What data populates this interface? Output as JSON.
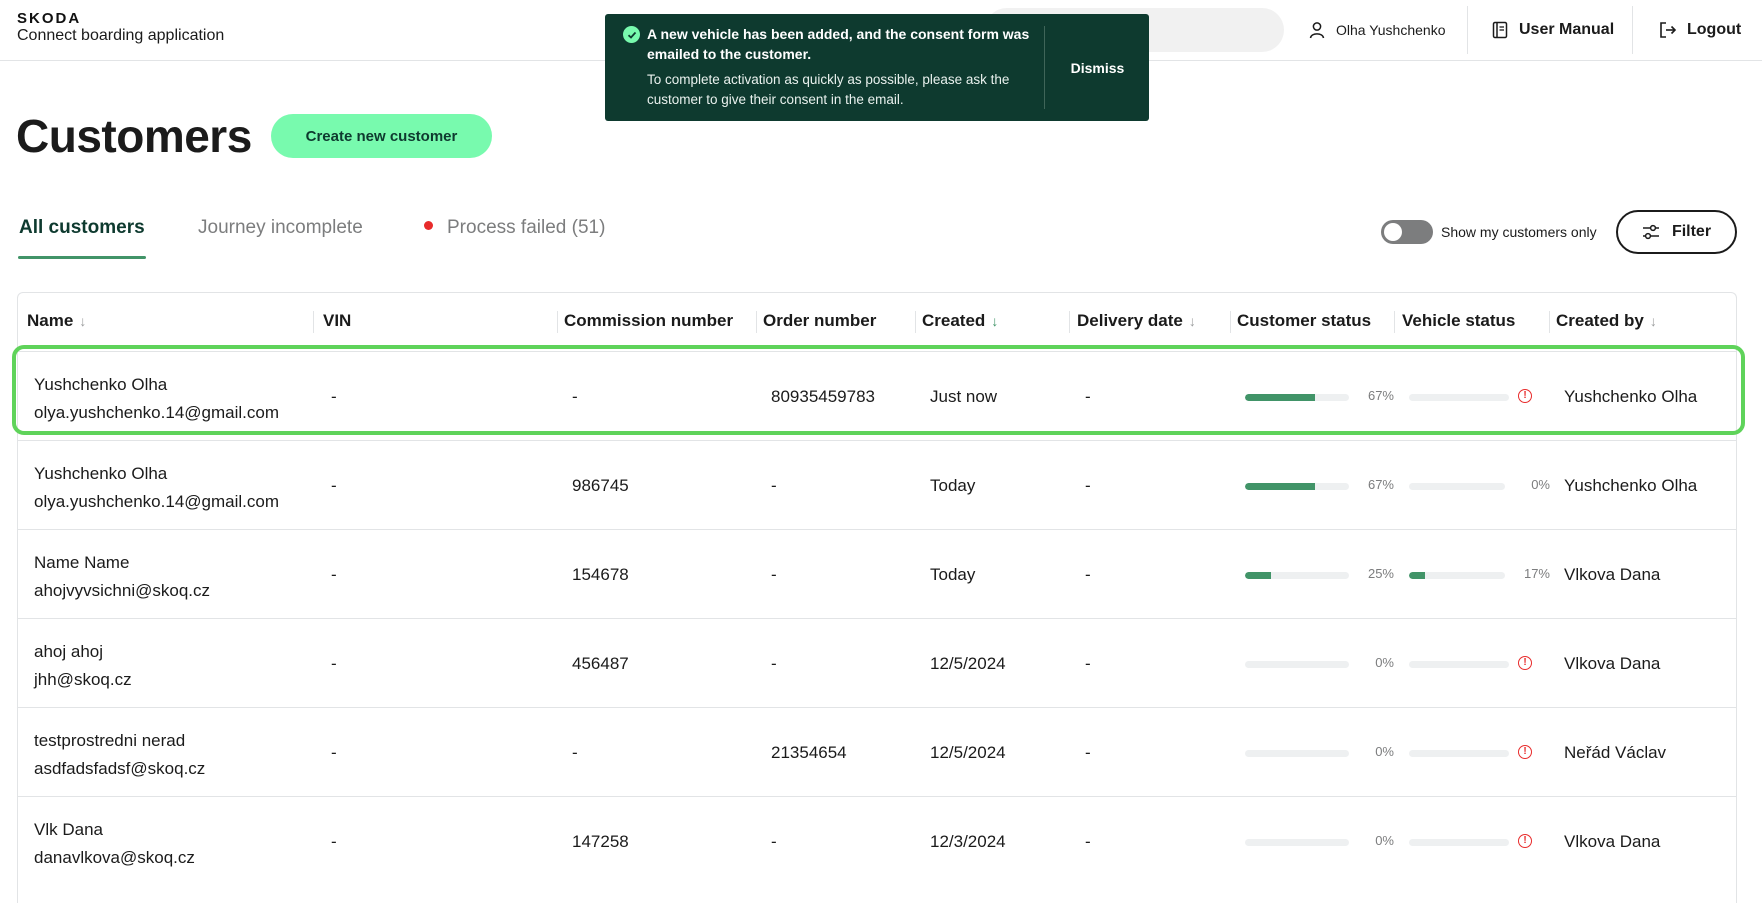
{
  "header": {
    "brand": "SKODA",
    "app_name": "Connect boarding application",
    "user_name": "Olha Yushchenko",
    "user_manual_label": "User Manual",
    "logout_label": "Logout"
  },
  "toast": {
    "title": "A new vehicle has been added, and the consent form was emailed to the customer.",
    "body": "To complete activation as quickly as possible, please ask the customer to give their consent in the email.",
    "dismiss_label": "Dismiss"
  },
  "page": {
    "title": "Customers",
    "create_button": "Create new customer"
  },
  "tabs": [
    {
      "label": "All customers",
      "active": true
    },
    {
      "label": "Journey incomplete",
      "active": false
    },
    {
      "label": "Process failed (51)",
      "active": false
    }
  ],
  "controls": {
    "toggle_label": "Show my customers only",
    "toggle_on": false,
    "filter_label": "Filter"
  },
  "colors": {
    "accent_green": "#78faae",
    "dark_green": "#0e3a2f",
    "progress_green": "#419468",
    "error_red": "#e82b2b",
    "highlight": "#5fd35a"
  },
  "table": {
    "columns": [
      "Name",
      "VIN",
      "Commission number",
      "Order number",
      "Created",
      "Delivery date",
      "Customer status",
      "Vehicle status",
      "Created by"
    ],
    "rows": [
      {
        "name": "Yushchenko Olha",
        "email": "olya.yushchenko.14@gmail.com",
        "vin": "-",
        "commission": "-",
        "order": "80935459783",
        "created": "Just now",
        "delivery": "-",
        "customer_pct": 67,
        "customer_label": "67%",
        "vehicle_pct": 0,
        "vehicle_label": "",
        "vehicle_error": true,
        "created_by": "Yushchenko Olha"
      },
      {
        "name": "Yushchenko Olha",
        "email": "olya.yushchenko.14@gmail.com",
        "vin": "-",
        "commission": "986745",
        "order": "-",
        "created": "Today",
        "delivery": "-",
        "customer_pct": 67,
        "customer_label": "67%",
        "vehicle_pct": 0,
        "vehicle_label": "0%",
        "vehicle_error": false,
        "created_by": "Yushchenko Olha"
      },
      {
        "name": "Name Name",
        "email": "ahojvyvsichni@skoq.cz",
        "vin": "-",
        "commission": "154678",
        "order": "-",
        "created": "Today",
        "delivery": "-",
        "customer_pct": 25,
        "customer_label": "25%",
        "vehicle_pct": 17,
        "vehicle_label": "17%",
        "vehicle_error": false,
        "created_by": "Vlkova Dana"
      },
      {
        "name": "ahoj ahoj",
        "email": "jhh@skoq.cz",
        "vin": "-",
        "commission": "456487",
        "order": "-",
        "created": "12/5/2024",
        "delivery": "-",
        "customer_pct": 0,
        "customer_label": "0%",
        "vehicle_pct": 0,
        "vehicle_label": "",
        "vehicle_error": true,
        "created_by": "Vlkova Dana"
      },
      {
        "name": "testprostredni nerad",
        "email": "asdfadsfadsf@skoq.cz",
        "vin": "-",
        "commission": "-",
        "order": "21354654",
        "created": "12/5/2024",
        "delivery": "-",
        "customer_pct": 0,
        "customer_label": "0%",
        "vehicle_pct": 0,
        "vehicle_label": "",
        "vehicle_error": true,
        "created_by": "Neřád Václav"
      },
      {
        "name": "Vlk Dana",
        "email": "danavlkova@skoq.cz",
        "vin": "-",
        "commission": "147258",
        "order": "-",
        "created": "12/3/2024",
        "delivery": "-",
        "customer_pct": 0,
        "customer_label": "0%",
        "vehicle_pct": 0,
        "vehicle_label": "",
        "vehicle_error": true,
        "created_by": "Vlkova Dana"
      }
    ]
  }
}
